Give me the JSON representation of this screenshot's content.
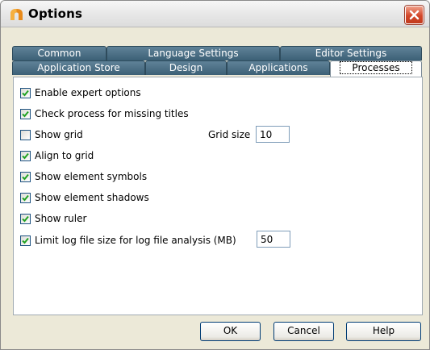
{
  "window": {
    "title": "Options"
  },
  "tabs_row1": [
    {
      "label": "Common"
    },
    {
      "label": "Language Settings"
    },
    {
      "label": "Editor Settings"
    }
  ],
  "tabs_row2": [
    {
      "label": "Application Store"
    },
    {
      "label": "Design"
    },
    {
      "label": "Applications"
    },
    {
      "label": "Processes"
    }
  ],
  "options": [
    {
      "label": "Enable expert options",
      "checked": true
    },
    {
      "label": "Check process for missing titles",
      "checked": true
    },
    {
      "label": "Show grid",
      "checked": false
    },
    {
      "label": "Align to grid",
      "checked": true
    },
    {
      "label": "Show element symbols",
      "checked": true
    },
    {
      "label": "Show element shadows",
      "checked": true
    },
    {
      "label": "Show ruler",
      "checked": true
    },
    {
      "label": "Limit log file size for log file analysis (MB)",
      "checked": true
    }
  ],
  "grid_size": {
    "label": "Grid size",
    "value": "10"
  },
  "log_size": {
    "value": "50"
  },
  "buttons": {
    "ok": "OK",
    "cancel": "Cancel",
    "help": "Help"
  },
  "colors": {
    "tab_bg": "#4a6e84",
    "close_red": "#d2472a",
    "checkbox_check": "#21a121"
  },
  "icons": {
    "app": "app-logo-icon",
    "close": "close-icon",
    "check": "checkmark-icon"
  }
}
